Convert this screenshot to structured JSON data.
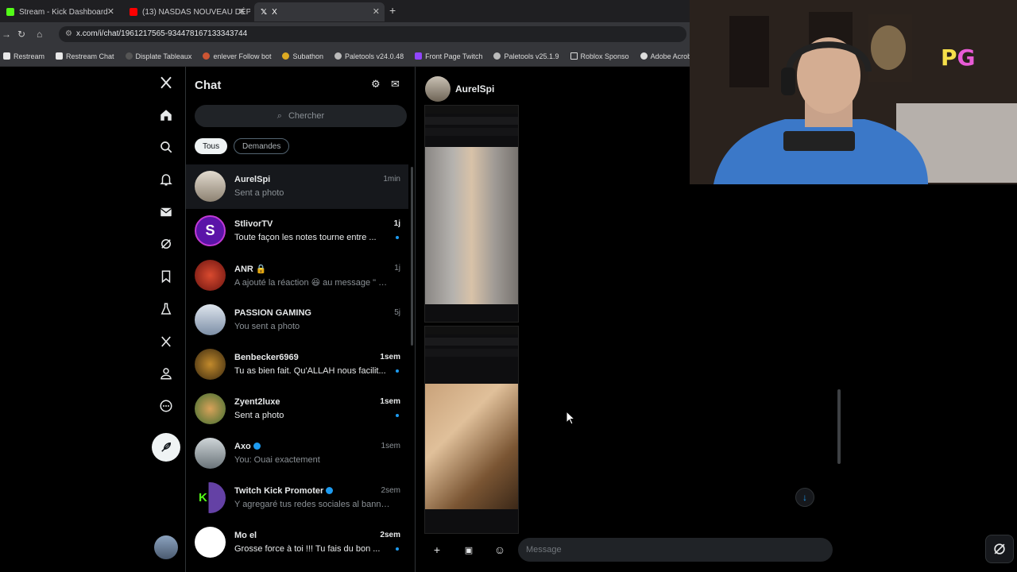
{
  "browser": {
    "tabs": [
      {
        "title": "Stream - Kick Dashboard",
        "active": false,
        "favicon_color": "#53fc18"
      },
      {
        "title": "(13) NASDAS NOUVEAU DÉPA",
        "active": false,
        "favicon_color": "#ff0000"
      },
      {
        "title": "X",
        "active": true,
        "favicon_color": "#ffffff"
      }
    ],
    "new_tab_label": "+",
    "url": "x.com/i/chat/1961217565-934478167133343744",
    "bookmarks": [
      {
        "label": "Restream",
        "color": "#e8e8e8"
      },
      {
        "label": "Restream Chat",
        "color": "#e8e8e8"
      },
      {
        "label": "Displate Tableaux",
        "color": "#555"
      },
      {
        "label": "enlever Follow bot",
        "color": "#cc5533"
      },
      {
        "label": "Subathon",
        "color": "#ddaa22"
      },
      {
        "label": "Paletools v24.0.48",
        "color": "#bbbbbb"
      },
      {
        "label": "Front Page Twitch",
        "color": "#9146ff"
      },
      {
        "label": "Paletools v25.1.9",
        "color": "#bbbbbb"
      },
      {
        "label": "Roblox Sponso",
        "color": "#dddddd"
      },
      {
        "label": "Adobe Acrobat",
        "color": "#dddddd"
      }
    ]
  },
  "nav": {
    "icons": [
      "x-logo-icon",
      "home-icon",
      "search-icon",
      "bell-icon",
      "mail-icon",
      "grok-icon",
      "bookmark-icon",
      "flask-icon",
      "x-premium-icon",
      "profile-icon",
      "more-icon"
    ]
  },
  "chat": {
    "title": "Chat",
    "search_placeholder": "Chercher",
    "filters": {
      "all": "Tous",
      "requests": "Demandes"
    },
    "conversations": [
      {
        "name": "AurelSpi",
        "message": "Sent a photo",
        "time": "1min",
        "unread": false,
        "selected": true,
        "verified": false,
        "avatar_color": "#b9b2a5",
        "avatar_text": ""
      },
      {
        "name": "StlivorTV",
        "message": "Toute façon les notes tourne entre ...",
        "time": "1j",
        "unread": true,
        "selected": false,
        "verified": false,
        "avatar_color": "#6a1fb8",
        "avatar_text": "S"
      },
      {
        "name": "ANR 🔒",
        "message": "A ajouté la réaction 😆 au message \" 🤣 \"",
        "time": "1j",
        "unread": false,
        "selected": false,
        "verified": false,
        "avatar_color": "#b3261e",
        "avatar_text": ""
      },
      {
        "name": "PASSION GAMING",
        "message": "You sent a photo",
        "time": "5j",
        "unread": false,
        "selected": false,
        "verified": false,
        "avatar_color": "#8fa0b5",
        "avatar_text": ""
      },
      {
        "name": "Benbecker6969",
        "message": "Tu as bien fait. Qu'ALLAH nous facilit...",
        "time": "1sem",
        "unread": true,
        "selected": false,
        "verified": false,
        "avatar_color": "#7a5a22",
        "avatar_text": ""
      },
      {
        "name": "Zyent2luxe",
        "message": "Sent a photo",
        "time": "1sem",
        "unread": true,
        "selected": false,
        "verified": false,
        "avatar_color": "#4a7a3a",
        "avatar_text": ""
      },
      {
        "name": "Axo",
        "message": "You: Ouai exactement",
        "time": "1sem",
        "unread": false,
        "selected": false,
        "verified": true,
        "avatar_color": "#9aa3a8",
        "avatar_text": ""
      },
      {
        "name": "Twitch Kick Promoter",
        "message": "Y agregaré tus redes sociales al banner ...",
        "time": "2sem",
        "unread": false,
        "selected": false,
        "verified": true,
        "avatar_color": "#6441a5",
        "avatar_text": "K"
      },
      {
        "name": "Mo el",
        "message": "Grosse force à toi !!! Tu fais du bon ...",
        "time": "2sem",
        "unread": true,
        "selected": false,
        "verified": false,
        "avatar_color": "#f5c842",
        "avatar_text": "😂"
      }
    ]
  },
  "conversation": {
    "name": "AurelSpi",
    "composer_placeholder": "Message"
  },
  "overlay": {
    "logo_p": "P",
    "logo_g": "G"
  }
}
